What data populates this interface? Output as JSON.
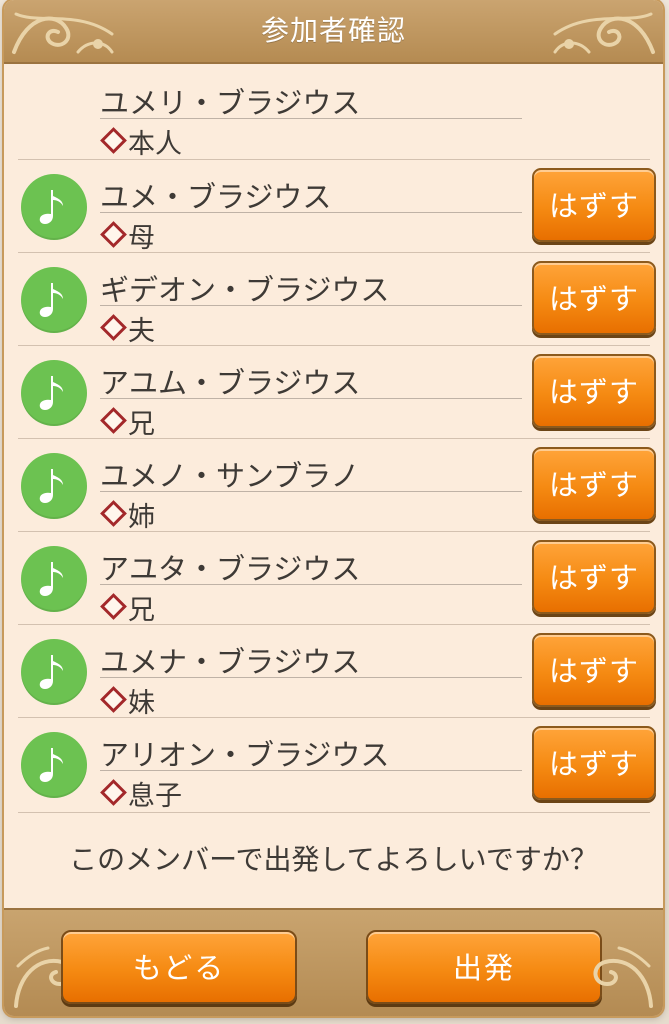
{
  "dialog": {
    "title": "参加者確認",
    "remove_label": "はずす",
    "confirm_text": "このメンバーで出発してよろしいですか？",
    "back_label": "もどる",
    "depart_label": "出発"
  },
  "members": [
    {
      "name": "ユメリ・ブラジウス",
      "relation": "本人",
      "removable": false
    },
    {
      "name": "ユメ・ブラジウス",
      "relation": "母",
      "removable": true
    },
    {
      "name": "ギデオン・ブラジウス",
      "relation": "夫",
      "removable": true
    },
    {
      "name": "アユム・ブラジウス",
      "relation": "兄",
      "removable": true
    },
    {
      "name": "ユメノ・サンブラノ",
      "relation": "姉",
      "removable": true
    },
    {
      "name": "アユタ・ブラジウス",
      "relation": "兄",
      "removable": true
    },
    {
      "name": "ユメナ・ブラジウス",
      "relation": "妹",
      "removable": true
    },
    {
      "name": "アリオン・ブラジウス",
      "relation": "息子",
      "removable": true
    }
  ],
  "colors": {
    "accent_orange": "#f58a12",
    "avatar_green": "#6cc251",
    "diamond_red": "#a3282a",
    "panel_cream": "#fcecdc",
    "frame_tan": "#b58b52"
  },
  "icons": {
    "avatar": "music-note-icon",
    "relation_marker": "diamond-icon",
    "ornament": "flourish-ornament-icon"
  }
}
